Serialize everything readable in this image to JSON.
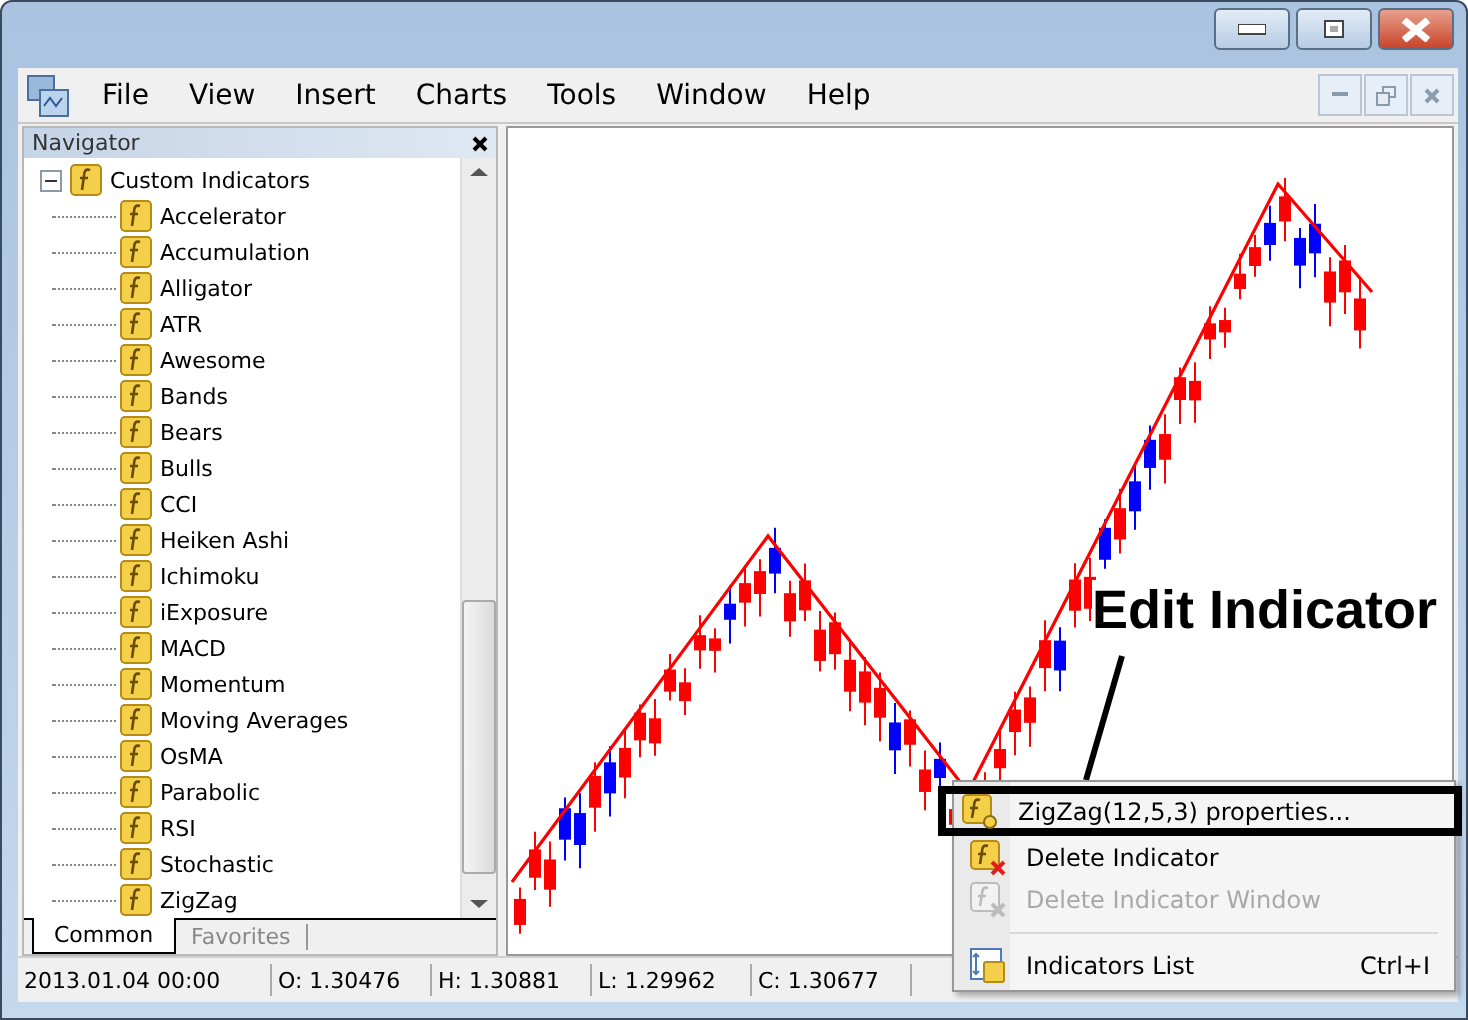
{
  "menu": [
    "File",
    "View",
    "Insert",
    "Charts",
    "Tools",
    "Window",
    "Help"
  ],
  "navigator": {
    "title": "Navigator",
    "tree": [
      {
        "label": "Custom Indicators",
        "expanded": true,
        "children": [
          {
            "label": "Accelerator"
          },
          {
            "label": "Accumulation"
          },
          {
            "label": "Alligator"
          },
          {
            "label": "ATR"
          },
          {
            "label": "Awesome"
          },
          {
            "label": "Bands"
          },
          {
            "label": "Bears"
          },
          {
            "label": "Bulls"
          },
          {
            "label": "CCI"
          },
          {
            "label": "Heiken Ashi"
          },
          {
            "label": "Ichimoku"
          },
          {
            "label": "iExposure"
          },
          {
            "label": "MACD"
          },
          {
            "label": "Momentum"
          },
          {
            "label": "Moving Averages"
          },
          {
            "label": "OsMA"
          },
          {
            "label": "Parabolic"
          },
          {
            "label": "RSI"
          },
          {
            "label": "Stochastic"
          },
          {
            "label": "ZigZag"
          }
        ]
      }
    ],
    "tabs": [
      {
        "label": "Common",
        "selected": true
      },
      {
        "label": "Favorites",
        "selected": false
      }
    ]
  },
  "chart": {
    "annotation": "Edit Indicator",
    "context_menu": [
      {
        "label": "ZigZag(12,5,3) properties...",
        "kind": "properties",
        "selected": true,
        "disabled": false,
        "separator_before": false
      },
      {
        "label": "Delete Indicator",
        "kind": "delete",
        "selected": false,
        "disabled": false,
        "separator_before": false
      },
      {
        "label": "Delete Indicator Window",
        "kind": "delete-window",
        "selected": false,
        "disabled": true,
        "separator_before": false
      },
      {
        "label": "Indicators List",
        "kind": "list",
        "shortcut": "Ctrl+I",
        "selected": false,
        "disabled": false,
        "separator_before": true
      }
    ]
  },
  "status_bar": [
    "2013.01.04 00:00",
    "O: 1.30476",
    "H: 1.30881",
    "L: 1.29962",
    "C: 1.30677"
  ]
}
